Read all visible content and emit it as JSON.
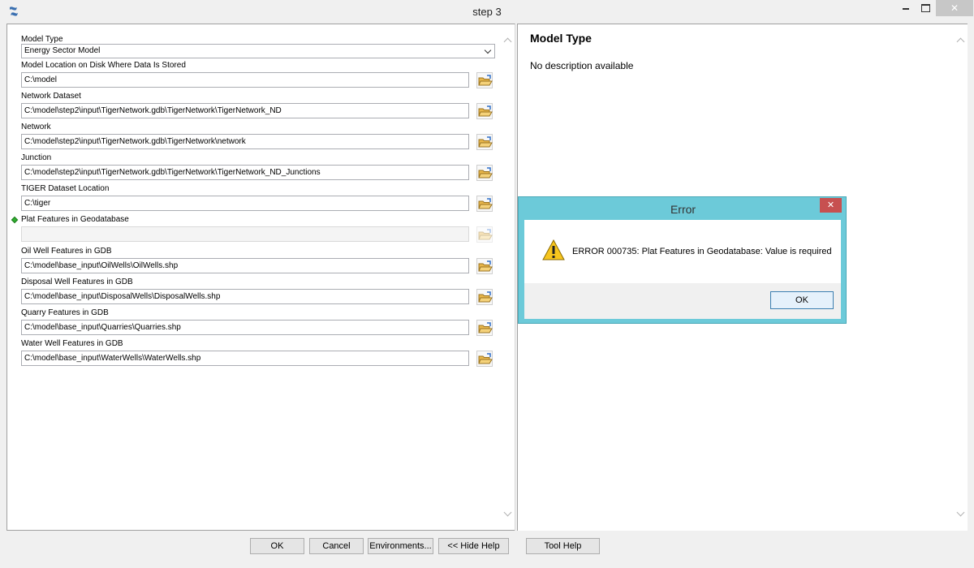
{
  "window": {
    "title": "step 3"
  },
  "params": [
    {
      "label": "Model Type",
      "value": "Energy Sector Model",
      "kind": "select"
    },
    {
      "label": "Model Location on Disk Where Data Is Stored",
      "value": "C:\\model"
    },
    {
      "label": "Network Dataset",
      "value": "C:\\model\\step2\\input\\TigerNetwork.gdb\\TigerNetwork\\TigerNetwork_ND"
    },
    {
      "label": "Network",
      "value": "C:\\model\\step2\\input\\TigerNetwork.gdb\\TigerNetwork\\network"
    },
    {
      "label": "Junction",
      "value": "C:\\model\\step2\\input\\TigerNetwork.gdb\\TigerNetwork\\TigerNetwork_ND_Junctions"
    },
    {
      "label": "TIGER Dataset Location",
      "value": "C:\\tiger"
    },
    {
      "label": "Plat Features in Geodatabase",
      "value": "",
      "required": true
    },
    {
      "label": "Oil Well Features in GDB",
      "value": "C:\\model\\base_input\\OilWells\\OilWells.shp"
    },
    {
      "label": "Disposal Well Features in GDB",
      "value": "C:\\model\\base_input\\DisposalWells\\DisposalWells.shp"
    },
    {
      "label": "Quarry Features in GDB",
      "value": "C:\\model\\base_input\\Quarries\\Quarries.shp"
    },
    {
      "label": "Water Well Features in GDB",
      "value": "C:\\model\\base_input\\WaterWells\\WaterWells.shp"
    }
  ],
  "help": {
    "title": "Model Type",
    "description": "No description available"
  },
  "buttons": {
    "ok": "OK",
    "cancel": "Cancel",
    "environments": "Environments...",
    "hide_help": "<< Hide Help",
    "tool_help": "Tool Help"
  },
  "error_dialog": {
    "title": "Error",
    "message": "ERROR 000735: Plat Features in Geodatabase: Value is required",
    "ok": "OK"
  },
  "icons": {
    "app": "python-tool-icon",
    "browse": "open-folder-icon",
    "warning": "warning-icon",
    "required": "green-dot-icon"
  },
  "colors": {
    "dialog_frame": "#6ccad9",
    "close_red": "#c75050",
    "required_dot": "#2fae2f"
  }
}
